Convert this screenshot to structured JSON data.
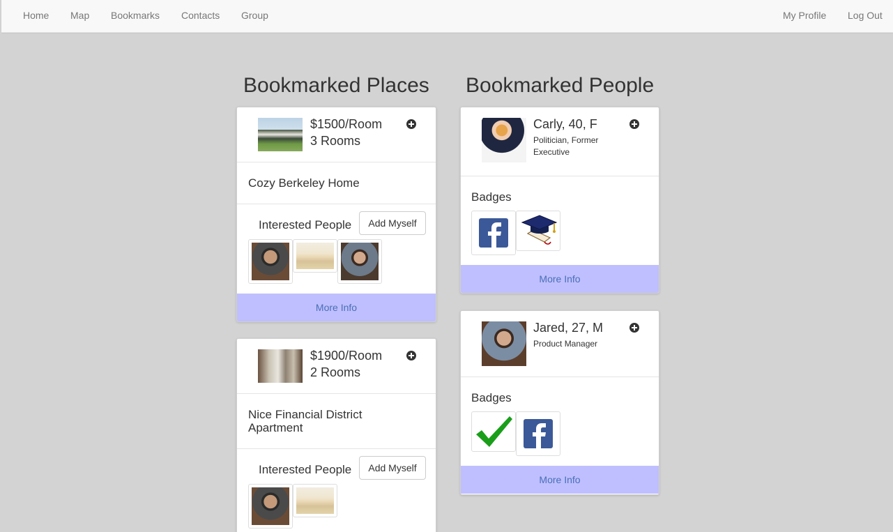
{
  "nav": {
    "left": [
      "Home",
      "Map",
      "Bookmarks",
      "Contacts",
      "Group"
    ],
    "right": [
      "My Profile",
      "Log Out"
    ]
  },
  "places": {
    "heading": "Bookmarked Places",
    "items": [
      {
        "price": "$1500/Room",
        "rooms": "3 Rooms",
        "title": "Cozy Berkeley Home",
        "interested_label": "Interested People",
        "add_button": "Add Myself",
        "more_info": "More Info"
      },
      {
        "price": "$1900/Room",
        "rooms": "2 Rooms",
        "title": "Nice Financial District Apartment",
        "interested_label": "Interested People",
        "add_button": "Add Myself",
        "more_info": "More Info"
      }
    ]
  },
  "people": {
    "heading": "Bookmarked People",
    "items": [
      {
        "name": "Carly, 40, F",
        "description": "Politician, Former Executive",
        "badges_label": "Badges",
        "badges": [
          "facebook-icon",
          "graduation-cap-icon"
        ],
        "more_info": "More Info"
      },
      {
        "name": "Jared, 27, M",
        "description": "Product Manager",
        "badges_label": "Badges",
        "badges": [
          "checkmark-icon",
          "facebook-icon"
        ],
        "more_info": "More Info"
      }
    ]
  },
  "colors": {
    "more_info_bg": "#bfbfff",
    "more_info_text": "#4a6fb5",
    "page_bg": "#d3d3d3",
    "facebook_blue": "#3b5998",
    "check_green": "#1a9e1a"
  }
}
